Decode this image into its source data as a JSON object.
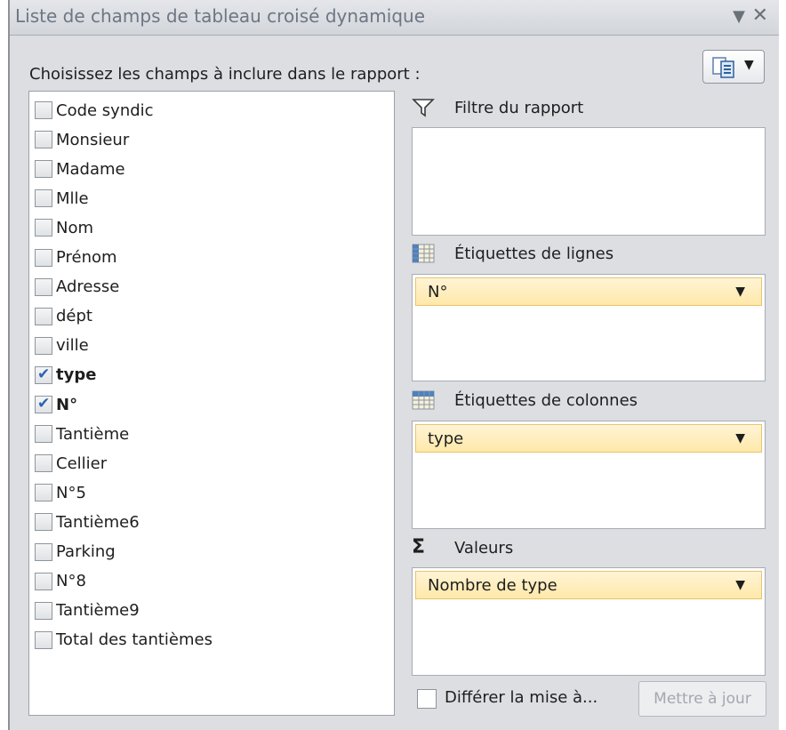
{
  "title_bar": {
    "title": "Liste de champs de tableau croisé dynamique",
    "dropdown_glyph": "▼",
    "close_glyph": "✕"
  },
  "instruction": "Choisissez les champs à inclure dans le rapport :",
  "layout_button": {
    "icon": "field-list-layout-icon",
    "caret": "▼"
  },
  "fields": [
    {
      "label": "Code syndic",
      "checked": false
    },
    {
      "label": "Monsieur",
      "checked": false
    },
    {
      "label": "Madame",
      "checked": false
    },
    {
      "label": "Mlle",
      "checked": false
    },
    {
      "label": "Nom",
      "checked": false
    },
    {
      "label": "Prénom",
      "checked": false
    },
    {
      "label": "Adresse",
      "checked": false
    },
    {
      "label": "dépt",
      "checked": false
    },
    {
      "label": "ville",
      "checked": false
    },
    {
      "label": "type",
      "checked": true
    },
    {
      "label": "N°",
      "checked": true
    },
    {
      "label": "Tantième",
      "checked": false
    },
    {
      "label": "Cellier",
      "checked": false
    },
    {
      "label": "N°5",
      "checked": false
    },
    {
      "label": "Tantième6",
      "checked": false
    },
    {
      "label": "Parking",
      "checked": false
    },
    {
      "label": "N°8",
      "checked": false
    },
    {
      "label": "Tantième9",
      "checked": false
    },
    {
      "label": "Total des tantièmes",
      "checked": false
    }
  ],
  "areas": {
    "report_filter": {
      "label": "Filtre du rapport",
      "icon": "filter-icon",
      "items": []
    },
    "row_labels": {
      "label": "Étiquettes de lignes",
      "icon": "row-labels-icon",
      "items": [
        "N°"
      ]
    },
    "column_labels": {
      "label": "Étiquettes de colonnes",
      "icon": "column-labels-icon",
      "items": [
        "type"
      ]
    },
    "values": {
      "label": "Valeurs",
      "icon": "sigma-icon",
      "icon_glyph": "Σ",
      "items": [
        "Nombre de type"
      ]
    }
  },
  "footer": {
    "defer_label": "Différer la mise à...",
    "defer_checked": false,
    "update_button": "Mettre à jour",
    "update_enabled": false
  },
  "colors": {
    "pane_bg": "#dcdee2",
    "field_pill": "#ffe8a8",
    "check_color": "#2c63b4"
  }
}
